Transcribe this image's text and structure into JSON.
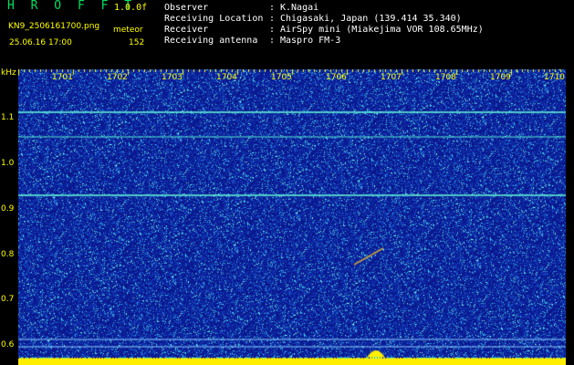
{
  "header": {
    "app_title": "H R O F F T",
    "app_version": "1.0.0f",
    "file_name": "KN9_2506161700.png",
    "mode_label": "meteor",
    "date_time": "25.06.16 17:00",
    "count_value": "152"
  },
  "info": {
    "rows": [
      {
        "key": "Observer",
        "value": "K.Nagai"
      },
      {
        "key": "Receiving Location",
        "value": "Chigasaki, Japan (139.414 35.340)"
      },
      {
        "key": "Receiver",
        "value": "AirSpy mini (Miakejima VOR 108.65MHz)"
      },
      {
        "key": "Receiving antenna",
        "value": "Maspro FM-3"
      }
    ],
    "separator": ":"
  },
  "axes": {
    "y_unit": "kHz",
    "y_ticks": [
      "1.1",
      "1.0",
      "0.9",
      "0.8",
      "0.7",
      "0.6"
    ],
    "x_ticks": [
      "1701",
      "1702",
      "1703",
      "1704",
      "1705",
      "1706",
      "1707",
      "1708",
      "1709",
      "1710"
    ]
  },
  "colors": {
    "background": "#000000",
    "title_green": "#00e060",
    "label_yellow": "#ffff00",
    "spectrum_base": "#0a1a90",
    "carrier_cyan": "#55ffd0"
  }
}
